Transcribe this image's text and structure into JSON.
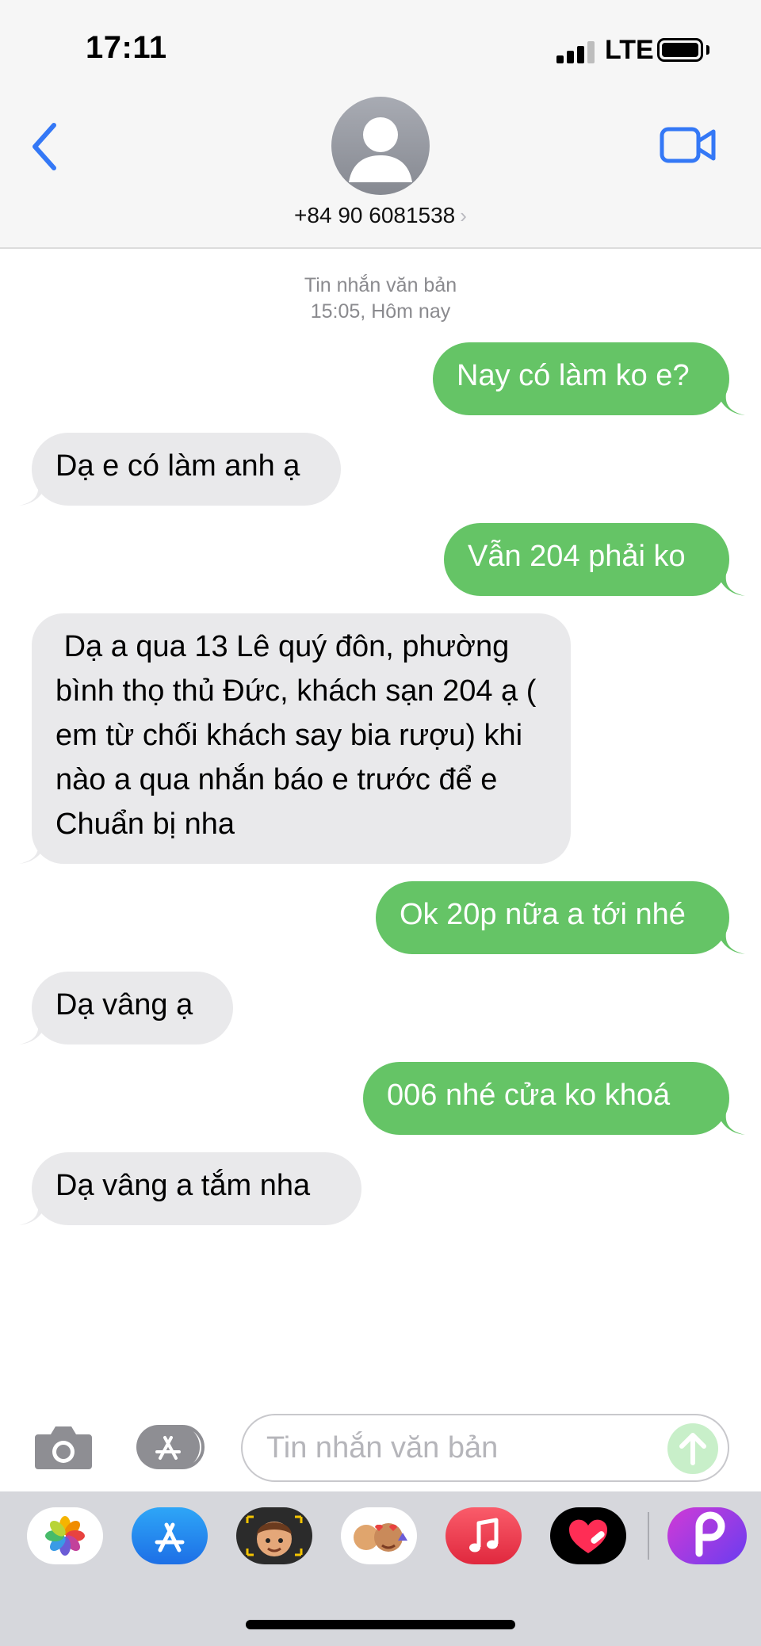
{
  "status_bar": {
    "time": "17:11",
    "network": "LTE"
  },
  "contact": {
    "name": "+84 90 6081538",
    "chevron": "›"
  },
  "conversation": {
    "meta_line1": "Tin nhắn văn bản",
    "meta_line2": "15:05, Hôm nay",
    "messages": [
      {
        "direction": "outgoing",
        "text": "Nay có làm ko e?"
      },
      {
        "direction": "incoming",
        "text": "Dạ e có làm anh ạ"
      },
      {
        "direction": "outgoing",
        "text": "Vẫn 204 phải ko"
      },
      {
        "direction": "incoming",
        "text": " Dạ a qua 13 Lê quý đôn, phường bình thọ thủ Đức, khách sạn 204 ạ ( em từ chối khách say bia rượu) khi nào a qua nhắn báo e trước để e Chuẩn bị nha"
      },
      {
        "direction": "outgoing",
        "text": "Ok 20p nữa a tới nhé"
      },
      {
        "direction": "incoming",
        "text": "Dạ vâng ạ"
      },
      {
        "direction": "outgoing",
        "text": "006 nhé cửa ko khoá"
      },
      {
        "direction": "incoming",
        "text": "Dạ vâng a tắm nha"
      }
    ]
  },
  "composer": {
    "placeholder": "Tin nhắn văn bản"
  },
  "icons": {
    "back": "chevron-left-icon",
    "video": "video-camera-icon",
    "camera": "camera-icon",
    "apps": "app-store-icon",
    "send": "arrow-up-icon"
  },
  "app_drawer": [
    "photos-app-icon",
    "app-store-app-icon",
    "memoji-app-icon",
    "animoji-stickers-app-icon",
    "music-app-icon",
    "digital-touch-app-icon",
    "picsart-app-icon"
  ],
  "colors": {
    "outgoing": "#65c466",
    "incoming": "#e9e9eb",
    "accent": "#3478f6"
  }
}
